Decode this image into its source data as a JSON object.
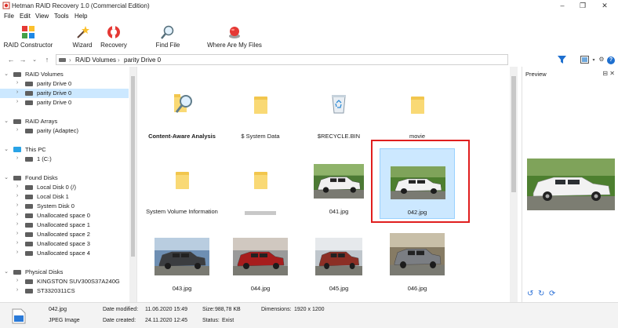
{
  "window": {
    "title": "Hetman RAID Recovery 1.0 (Commercial Edition)",
    "controls": [
      "minimize",
      "maximize",
      "close"
    ]
  },
  "menu": [
    "File",
    "Edit",
    "View",
    "Tools",
    "Help"
  ],
  "toolbar": {
    "buttons": [
      {
        "label": "RAID Constructor",
        "icon": "raid-constructor-icon"
      },
      {
        "label": "Wizard",
        "icon": "wizard-icon"
      },
      {
        "label": "Recovery",
        "icon": "recovery-lifebuoy-icon"
      },
      {
        "label": "Find File",
        "icon": "magnifier-icon"
      },
      {
        "label": "Where Are My Files",
        "icon": "red-button-icon"
      }
    ]
  },
  "address": {
    "crumbs": [
      "RAID Volumes",
      "parity Drive 0"
    ]
  },
  "tree": {
    "groups": [
      {
        "label": "RAID Volumes",
        "children": [
          "parity Drive 0",
          "parity Drive 0",
          "parity Drive 0"
        ],
        "selected_child": 1
      },
      {
        "label": "RAID Arrays",
        "children": [
          "parity (Adaptec)"
        ]
      },
      {
        "label": "This PC",
        "children": [
          "1 (C:)"
        ]
      },
      {
        "label": "Found Disks",
        "children": [
          "Local Disk 0 (/)",
          "Local Disk 1",
          "System Disk 0",
          "Unallocated space 0",
          "Unallocated space 1",
          "Unallocated space 2",
          "Unallocated space 3",
          "Unallocated space 4"
        ]
      },
      {
        "label": "Physical Disks",
        "children": [
          "KINGSTON SUV300S37A240G",
          "ST3320311CS"
        ]
      }
    ]
  },
  "files": [
    {
      "name": "Content-Aware Analysis",
      "type": "analysis",
      "bold": true
    },
    {
      "name": "$ System Data",
      "type": "folder"
    },
    {
      "name": "$RECYCLE.BIN",
      "type": "recycle"
    },
    {
      "name": "movie",
      "type": "folder"
    },
    {
      "name": "System Volume Information",
      "type": "folder"
    },
    {
      "name": "",
      "type": "folder-blurred"
    },
    {
      "name": "041.jpg",
      "type": "photo"
    },
    {
      "name": "042.jpg",
      "type": "photo",
      "selected": true
    },
    {
      "name": "043.jpg",
      "type": "photo"
    },
    {
      "name": "044.jpg",
      "type": "photo"
    },
    {
      "name": "045.jpg",
      "type": "photo"
    },
    {
      "name": "046.jpg",
      "type": "photo"
    }
  ],
  "preview": {
    "title": "Preview"
  },
  "status": {
    "file_name": "042.jpg",
    "file_type": "JPEG Image",
    "date_modified_label": "Date modified:",
    "date_modified": "11.06.2020 15:49",
    "date_created_label": "Date created:",
    "date_created": "24.11.2020 12:45",
    "size_label": "Size:",
    "size": "988,78 KB",
    "status_label": "Status:",
    "status": "Exist",
    "dimensions_label": "Dimensions:",
    "dimensions": "1920 x 1200"
  },
  "colors": {
    "selection": "#cce8ff",
    "highlight_frame": "#e01e1e",
    "folder": "#f9d975"
  }
}
